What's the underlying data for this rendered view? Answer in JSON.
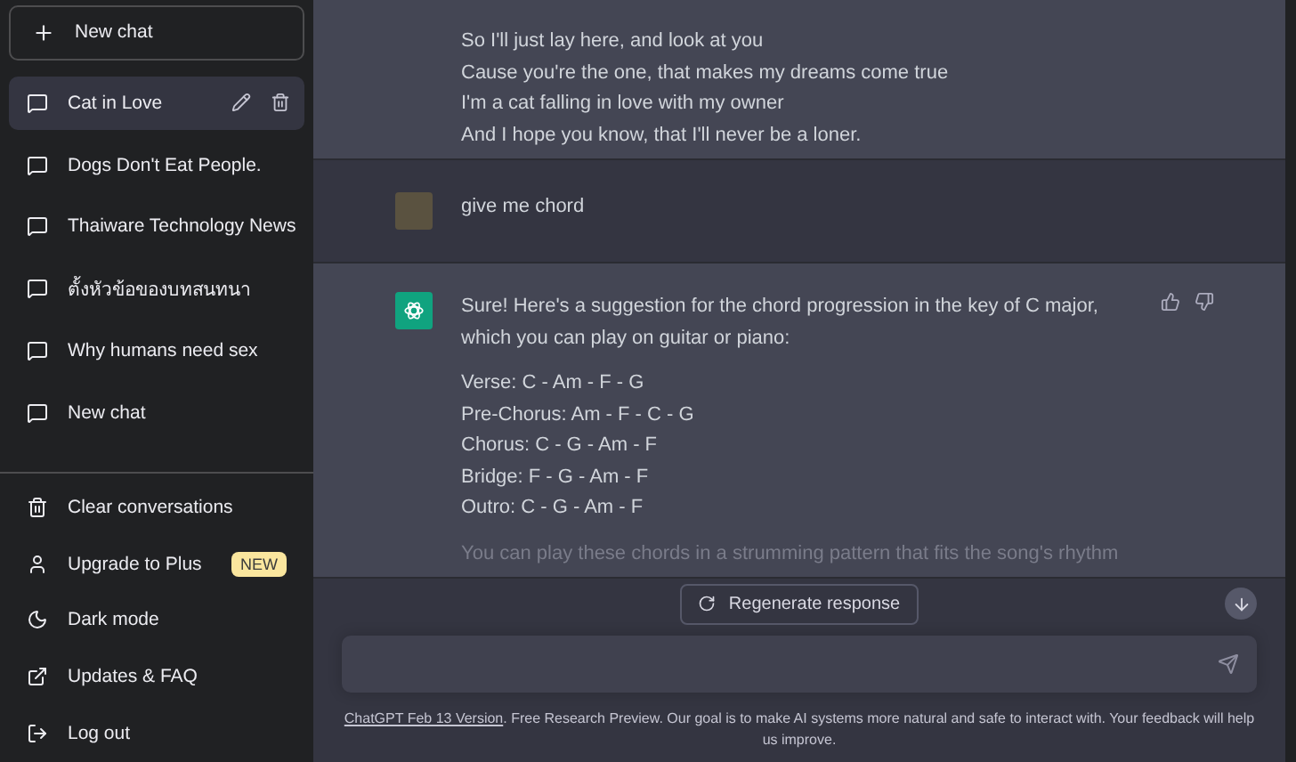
{
  "sidebar": {
    "new_chat_button": "New chat",
    "conversations": [
      {
        "title": "Cat in Love",
        "selected": true
      },
      {
        "title": "Dogs Don't Eat People.",
        "selected": false
      },
      {
        "title": "Thaiware Technology News",
        "selected": false
      },
      {
        "title": "ตั้งหัวข้อของบทสนทนา",
        "selected": false
      },
      {
        "title": "Why humans need sex",
        "selected": false
      },
      {
        "title": "New chat",
        "selected": false
      }
    ],
    "menu": [
      {
        "kind": "trash",
        "label": "Clear conversations"
      },
      {
        "kind": "user",
        "label": "Upgrade to Plus",
        "badge": "NEW"
      },
      {
        "kind": "moon",
        "label": "Dark mode"
      },
      {
        "kind": "external",
        "label": "Updates & FAQ"
      },
      {
        "kind": "logout",
        "label": "Log out"
      }
    ]
  },
  "messages": [
    {
      "kind": "assistant_continued",
      "blocks": [
        {
          "kind": "lines",
          "lines": [
            "So I'll just lay here, and look at you",
            "Cause you're the one, that makes my dreams come true",
            "I'm a cat falling in love with my owner",
            "And I hope you know, that I'll never be a loner."
          ]
        }
      ]
    },
    {
      "kind": "user",
      "blocks": [
        {
          "kind": "para",
          "text": "give me chord"
        }
      ]
    },
    {
      "kind": "assistant",
      "blocks": [
        {
          "kind": "para",
          "text": "Sure! Here's a suggestion for the chord progression in the key of C major, which you can play on guitar or piano:"
        },
        {
          "kind": "lines",
          "lines": [
            "Verse: C - Am - F - G",
            "Pre-Chorus: Am - F - C - G",
            "Chorus: C - G - Am - F",
            "Bridge: F - G - Am - F",
            "Outro: C - G - Am - F"
          ]
        },
        {
          "kind": "faded",
          "text": "You can play these chords in a strumming pattern that fits the song's rhythm"
        }
      ]
    }
  ],
  "regenerate_button": "Regenerate response",
  "footer": {
    "link": "ChatGPT Feb 13 Version",
    "text": ". Free Research Preview. Our goal is to make AI systems more natural and safe to interact with. Your feedback will help us improve."
  }
}
